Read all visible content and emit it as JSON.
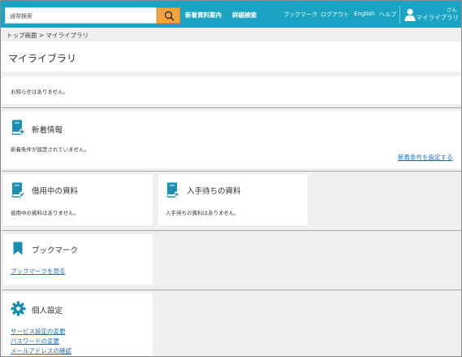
{
  "header": {
    "search_placeholder": "通常検索",
    "nav_new_arrivals": "新着資料案内",
    "nav_advanced_search": "詳細検索",
    "nav_bookmarks": "ブックマーク",
    "nav_logout": "ログアウト",
    "nav_english": "English",
    "nav_help": "ヘルプ",
    "user_suffix": "さん",
    "user_library": "マイライブラリ"
  },
  "breadcrumb": "トップ画面 > マイライブラリ",
  "page_title": "マイライブラリ",
  "notice": "お知らせはありません。",
  "new_info": {
    "title": "新着情報",
    "text": "新着条件が設定されていません。",
    "link": "新着条件を設定する"
  },
  "borrowing": {
    "title": "借用中の資料",
    "text": "借用中の資料はありません。"
  },
  "waiting": {
    "title": "入手待ちの資料",
    "text": "入手待ちの資料はありません。"
  },
  "bookmark": {
    "title": "ブックマーク",
    "link": "ブックマークを見る"
  },
  "settings": {
    "title": "個人設定",
    "links": [
      "サービス設定の変更",
      "パスワードの変更",
      "メールアドレスの確認"
    ]
  },
  "colors": {
    "header": "#1aa3c2",
    "search_button": "#f4a340",
    "link": "#1f6fb5",
    "icon": "#1a8fb0"
  }
}
